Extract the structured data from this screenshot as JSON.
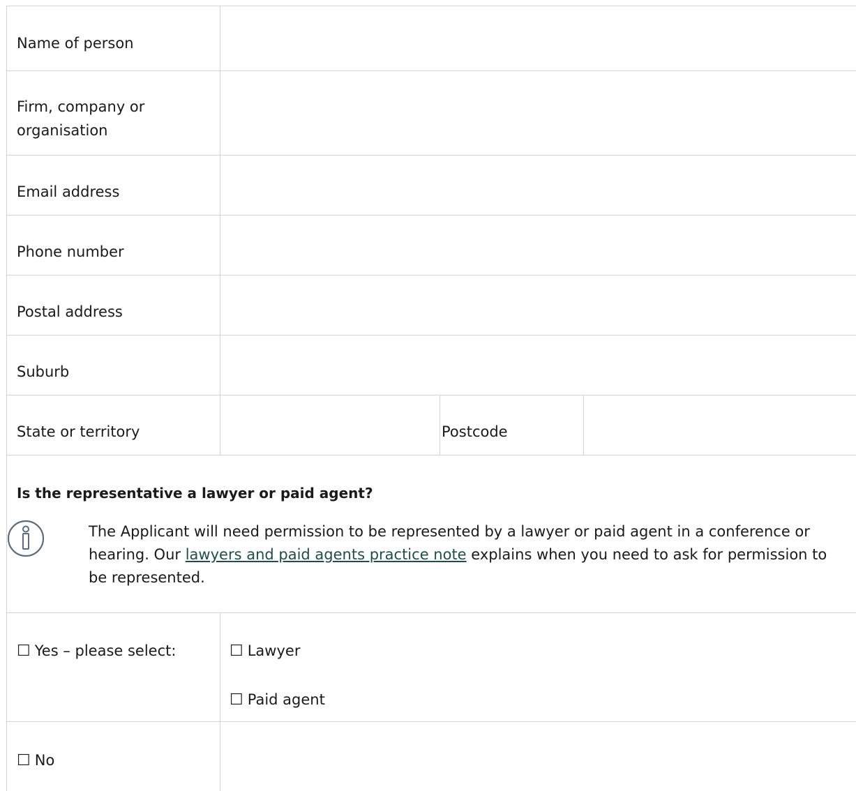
{
  "fields": {
    "name": "Name of person",
    "firm_line1": "Firm, company or",
    "firm_line2": "organisation",
    "email": "Email address",
    "phone": "Phone number",
    "postal": "Postal address",
    "suburb": "Suburb",
    "state": "State or territory",
    "postcode": "Postcode"
  },
  "question": {
    "heading": "Is the representative a lawyer or paid agent?",
    "info_before": "The Applicant will need permission to be represented by a lawyer or paid agent in a conference or hearing. Our ",
    "info_link": "lawyers and paid agents practice note",
    "info_after": " explains when you need to ask for permission to be represented."
  },
  "options": {
    "checkbox_glyph": "☐",
    "yes": "Yes – please select:",
    "lawyer": "Lawyer",
    "paid_agent": "Paid agent",
    "no": "No"
  },
  "colors": {
    "border": "#d4d4d4",
    "link": "#1f4e4a",
    "icon": "#5a6b82"
  }
}
